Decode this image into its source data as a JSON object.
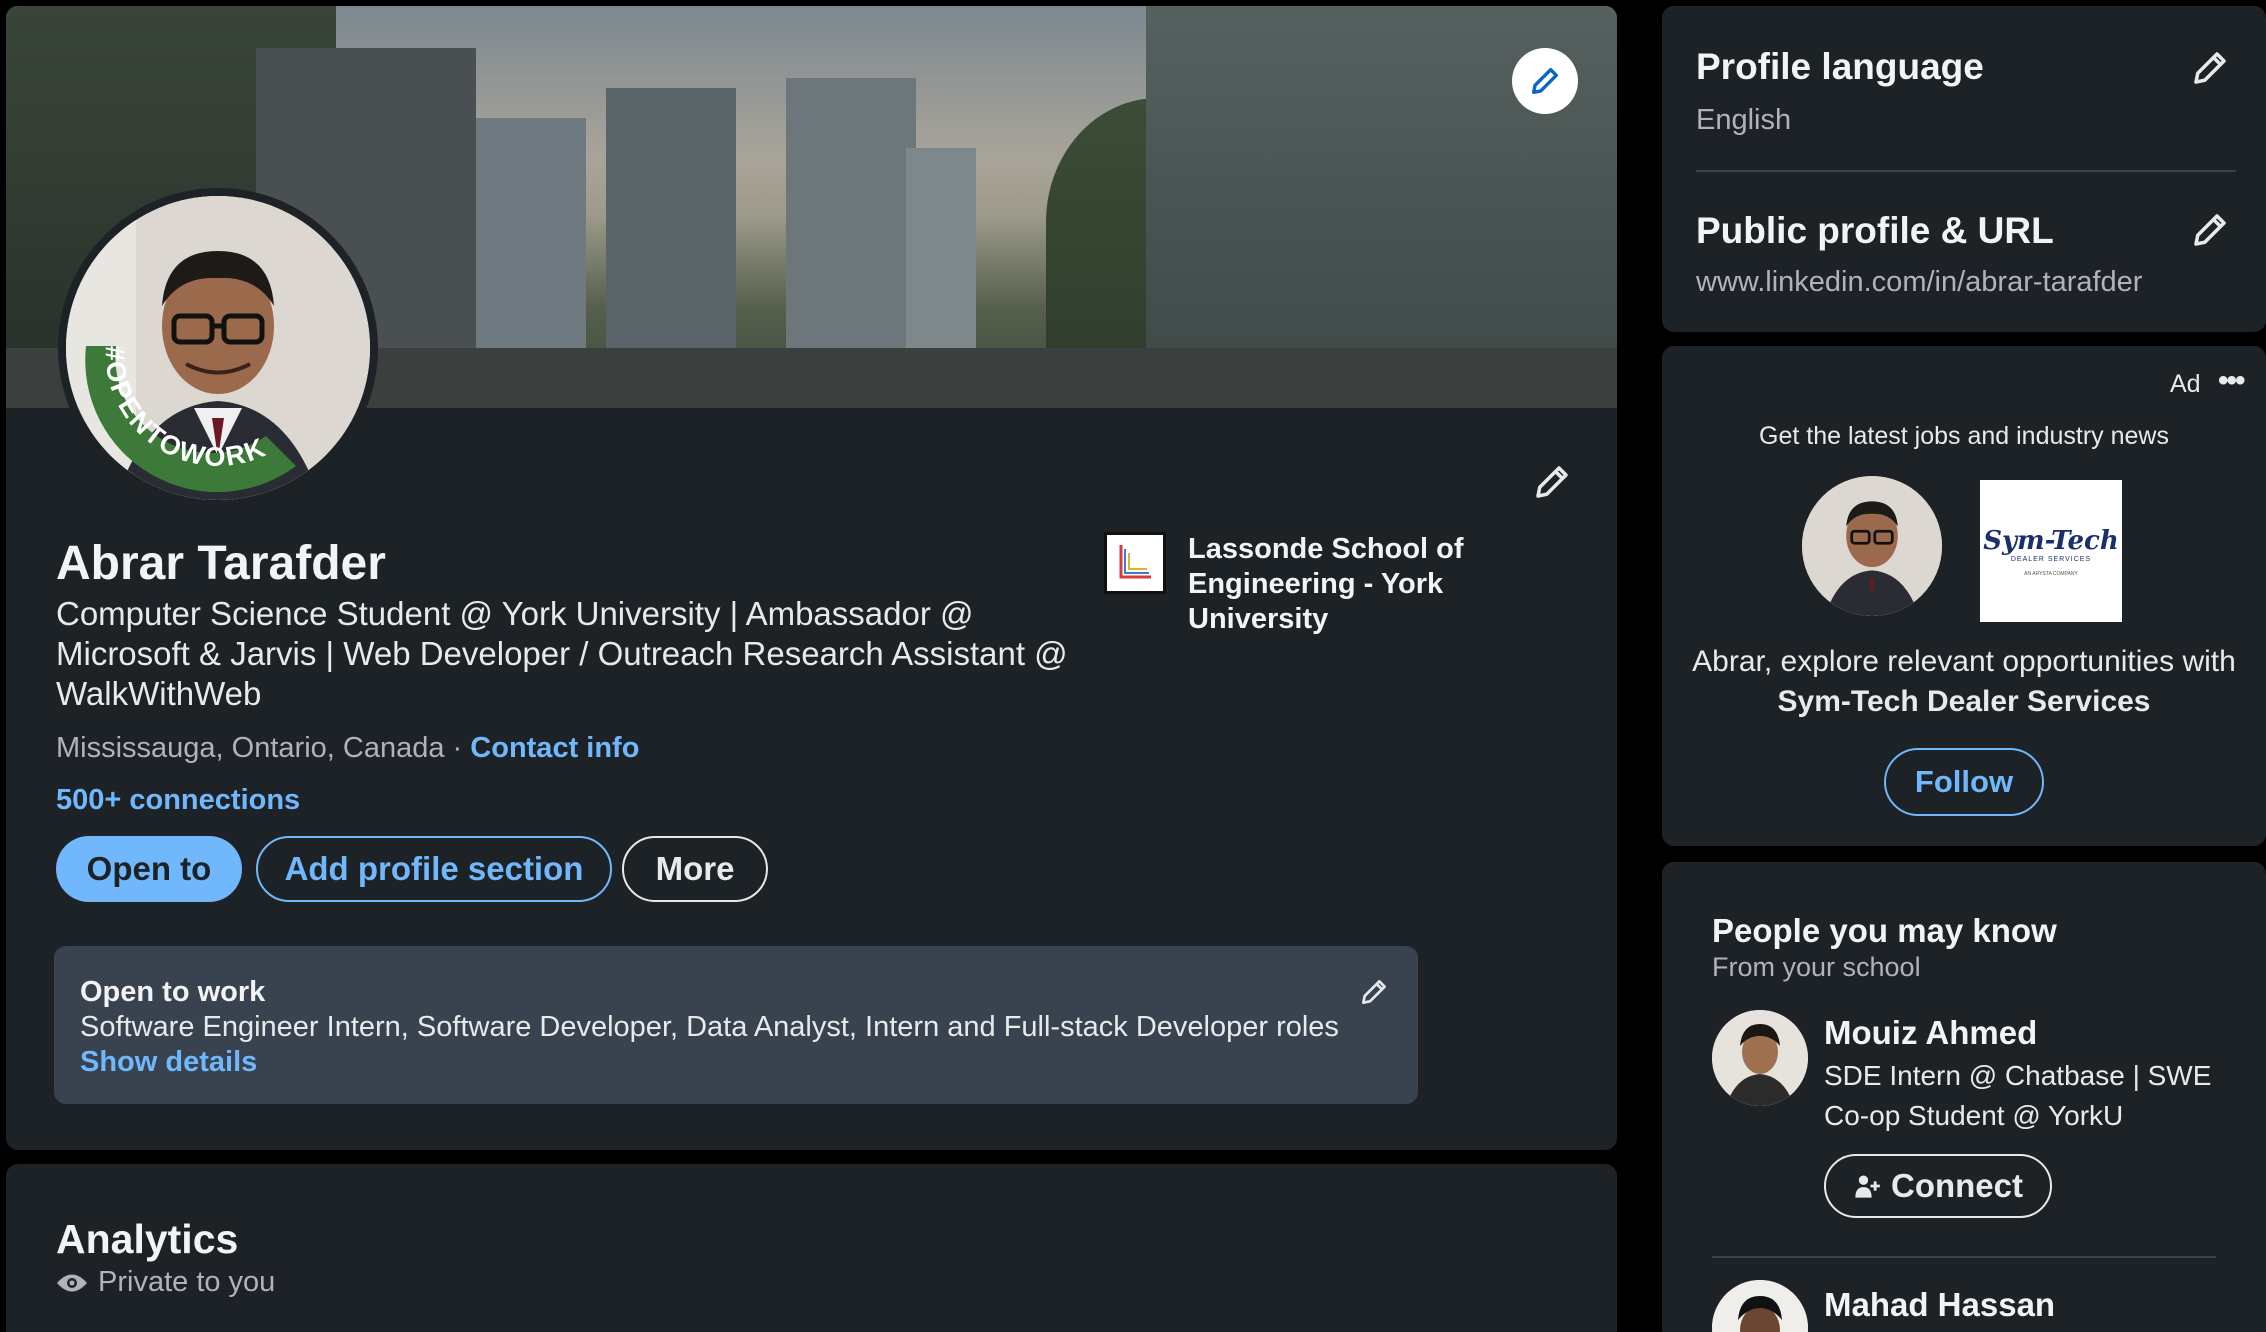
{
  "profile": {
    "name": "Abrar Tarafder",
    "headline": "Computer Science Student @ York University | Ambassador @ Microsoft & Jarvis | Web Developer / Outreach Research Assistant @ WalkWithWeb",
    "location": "Mississauga, Ontario, Canada",
    "separator": "·",
    "contact_info": "Contact info",
    "connections": "500+ connections",
    "open_to_work_frame_text": "#OPENTOWORK",
    "education": "Lassonde School of Engineering - York University"
  },
  "actions": {
    "open_to": "Open to",
    "add_section": "Add profile section",
    "more": "More"
  },
  "open_to_work": {
    "title": "Open to work",
    "roles": "Software Engineer Intern, Software Developer, Data Analyst, Intern and Full-stack Developer roles",
    "details_link": "Show details"
  },
  "analytics": {
    "title": "Analytics",
    "privacy": "Private to you"
  },
  "settings": {
    "language_title": "Profile language",
    "language_value": "English",
    "url_title": "Public profile & URL",
    "url_value": "www.linkedin.com/in/abrar-tarafder"
  },
  "ad": {
    "label": "Ad",
    "more": "•••",
    "tagline": "Get the latest jobs and industry news",
    "message_prefix": "Abrar, explore relevant opportunities with ",
    "company": "Sym-Tech Dealer Services",
    "logo_line1": "Sym-Tech",
    "logo_line2": "DEALER SERVICES",
    "logo_line3": "AN ARYSTA COMPANY",
    "follow": "Follow"
  },
  "pymk": {
    "title": "People you may know",
    "subtitle": "From your school",
    "people": [
      {
        "name": "Mouiz Ahmed",
        "headline": "SDE Intern @ Chatbase | SWE Co-op Student @ YorkU",
        "action": "Connect"
      },
      {
        "name": "Mahad Hassan"
      }
    ]
  },
  "colors": {
    "background": "#000000",
    "card": "#1d2226",
    "accent": "#71b7fb",
    "open_to_work_green": "#3d7a3a"
  }
}
